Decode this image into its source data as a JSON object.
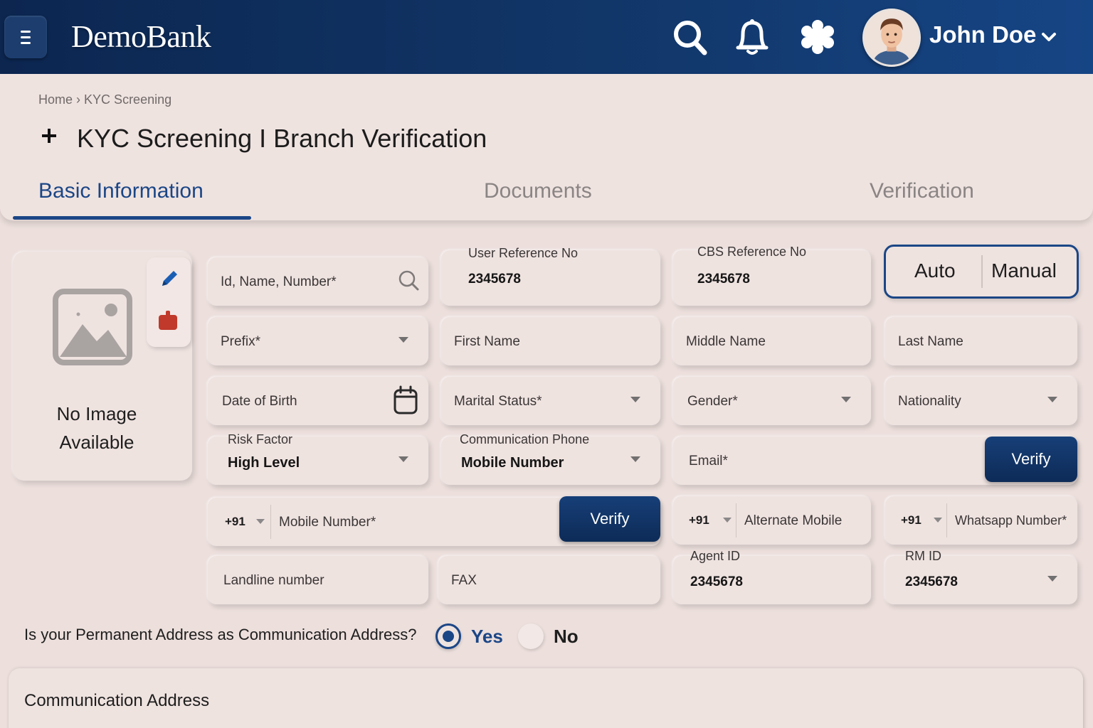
{
  "app": {
    "brand": "DemoBank"
  },
  "header": {
    "user_name": "John Doe"
  },
  "breadcrumb": {
    "home": "Home",
    "separator": "›",
    "current": "KYC Screening"
  },
  "page": {
    "title": "KYC Screening I Branch Verification"
  },
  "tabs": [
    {
      "label": "Basic Information",
      "active": true
    },
    {
      "label": "Documents",
      "active": false
    },
    {
      "label": "Verification",
      "active": false
    }
  ],
  "photo": {
    "no_image_line1": "No Image",
    "no_image_line2": "Available"
  },
  "form": {
    "search": {
      "placeholder": "Id, Name, Number*"
    },
    "user_ref": {
      "label": "User Reference No",
      "value": "2345678"
    },
    "cbs_ref": {
      "label": "CBS Reference No",
      "value": "2345678"
    },
    "mode_toggle": {
      "auto": "Auto",
      "manual": "Manual"
    },
    "prefix": {
      "placeholder": "Prefix*"
    },
    "first_name": {
      "placeholder": "First Name"
    },
    "middle_name": {
      "placeholder": "Middle Name"
    },
    "last_name": {
      "placeholder": "Last Name"
    },
    "dob": {
      "placeholder": "Date of Birth"
    },
    "marital_status": {
      "placeholder": "Marital Status*"
    },
    "gender": {
      "placeholder": "Gender*"
    },
    "nationality": {
      "placeholder": "Nationality"
    },
    "risk_factor": {
      "label": "Risk Factor",
      "value": "High Level"
    },
    "comm_phone": {
      "label": "Communication Phone",
      "value": "Mobile Number"
    },
    "email": {
      "placeholder": "Email*",
      "verify_label": "Verify"
    },
    "mobile": {
      "country_code": "+91",
      "placeholder": "Mobile Number*",
      "verify_label": "Verify"
    },
    "alt_mobile": {
      "country_code": "+91",
      "placeholder": "Alternate Mobile"
    },
    "whatsapp": {
      "country_code": "+91",
      "placeholder": "Whatsapp Number*"
    },
    "landline": {
      "placeholder": "Landline number"
    },
    "fax": {
      "placeholder": "FAX"
    },
    "agent_id": {
      "label": "Agent ID",
      "value": "2345678"
    },
    "rm_id": {
      "label": "RM ID",
      "value": "2345678"
    }
  },
  "address_question": {
    "text": "Is your Permanent Address as Communication Address?",
    "yes": "Yes",
    "no": "No",
    "selected": "Yes"
  },
  "communication_address": {
    "title": "Communication Address"
  },
  "colors": {
    "primary": "#1b4686",
    "topbar": "#113668",
    "background": "#ecdfdc",
    "delete": "#c0392b"
  }
}
